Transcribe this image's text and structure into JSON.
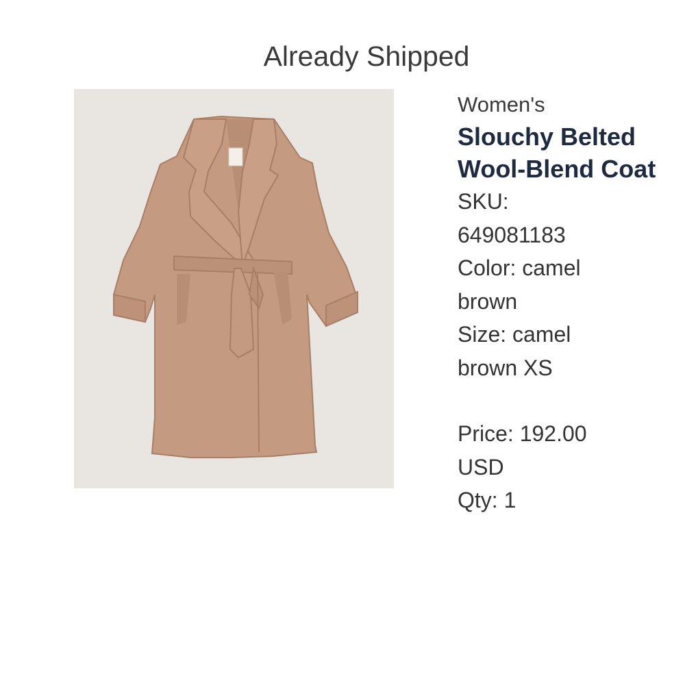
{
  "order": {
    "status": "Already Shipped"
  },
  "product": {
    "image_alt": "camel brown belted wool-blend coat",
    "gender": "Women's",
    "name": "Slouchy Belted Wool-Blend Coat",
    "sku_label": "SKU:",
    "sku_value": "649081183",
    "color_label": "Color:",
    "color_value": "camel brown",
    "size_label": "Size:",
    "size_value": "camel brown XS",
    "price_label": "Price:",
    "price_value": "192.00 USD",
    "qty_label": "Qty:",
    "qty_value": "1"
  },
  "colors": {
    "background": "#ffffff",
    "image_bg": "#e9e5e1",
    "coat": "#c49a80",
    "product_name": "#1e2a40",
    "text": "#333333"
  }
}
